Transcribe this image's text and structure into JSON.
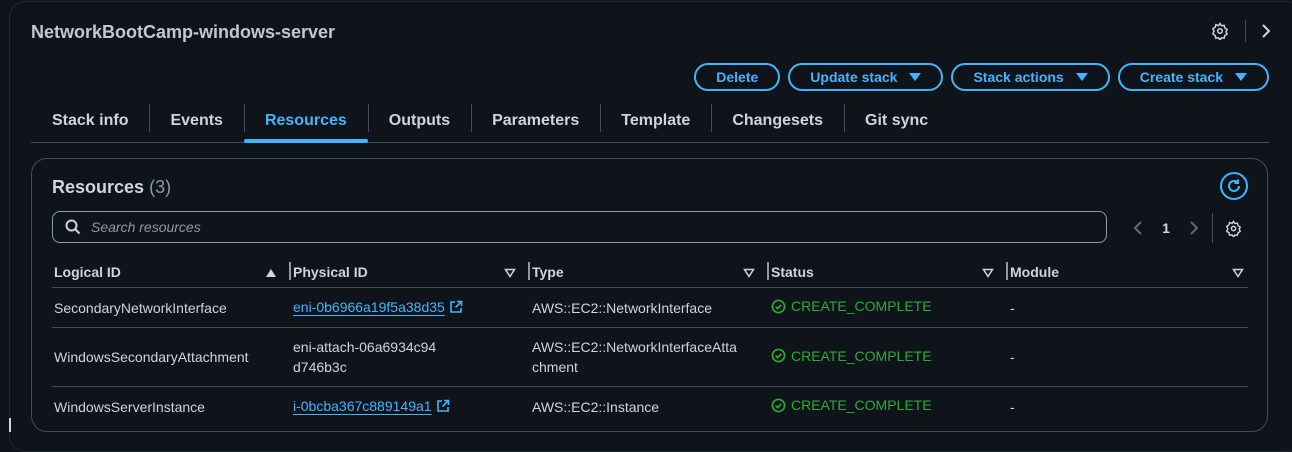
{
  "header": {
    "title": "NetworkBootCamp-windows-server"
  },
  "actions": {
    "delete": "Delete",
    "update_stack": "Update stack",
    "stack_actions": "Stack actions",
    "create_stack": "Create stack"
  },
  "tabs": [
    "Stack info",
    "Events",
    "Resources",
    "Outputs",
    "Parameters",
    "Template",
    "Changesets",
    "Git sync"
  ],
  "active_tab": "Resources",
  "resources": {
    "title": "Resources",
    "count": "(3)",
    "search_placeholder": "Search resources",
    "page": "1",
    "columns": [
      "Logical ID",
      "Physical ID",
      "Type",
      "Status",
      "Module"
    ],
    "rows": [
      {
        "logical_id": "SecondaryNetworkInterface",
        "physical_id": "eni-0b6966a19f5a38d35",
        "physical_link": true,
        "type": "AWS::EC2::NetworkInterface",
        "status": "CREATE_COMPLETE",
        "module": "-"
      },
      {
        "logical_id": "WindowsSecondaryAttachment",
        "physical_id": "eni-attach-06a6934c94d746b3c",
        "physical_link": false,
        "type": "AWS::EC2::NetworkInterfaceAttachment",
        "status": "CREATE_COMPLETE",
        "module": "-"
      },
      {
        "logical_id": "WindowsServerInstance",
        "physical_id": "i-0bcba367c889149a1",
        "physical_link": true,
        "type": "AWS::EC2::Instance",
        "status": "CREATE_COMPLETE",
        "module": "-"
      }
    ]
  },
  "colors": {
    "accent": "#42b4ff",
    "success": "#29ad32",
    "background": "#0f141a"
  },
  "icons": [
    "settings-gear-icon",
    "chevron-right-icon",
    "caret-down-icon",
    "refresh-icon",
    "search-icon",
    "chevron-left-icon",
    "sort-ascending-icon",
    "external-link-icon",
    "check-circle-icon"
  ]
}
